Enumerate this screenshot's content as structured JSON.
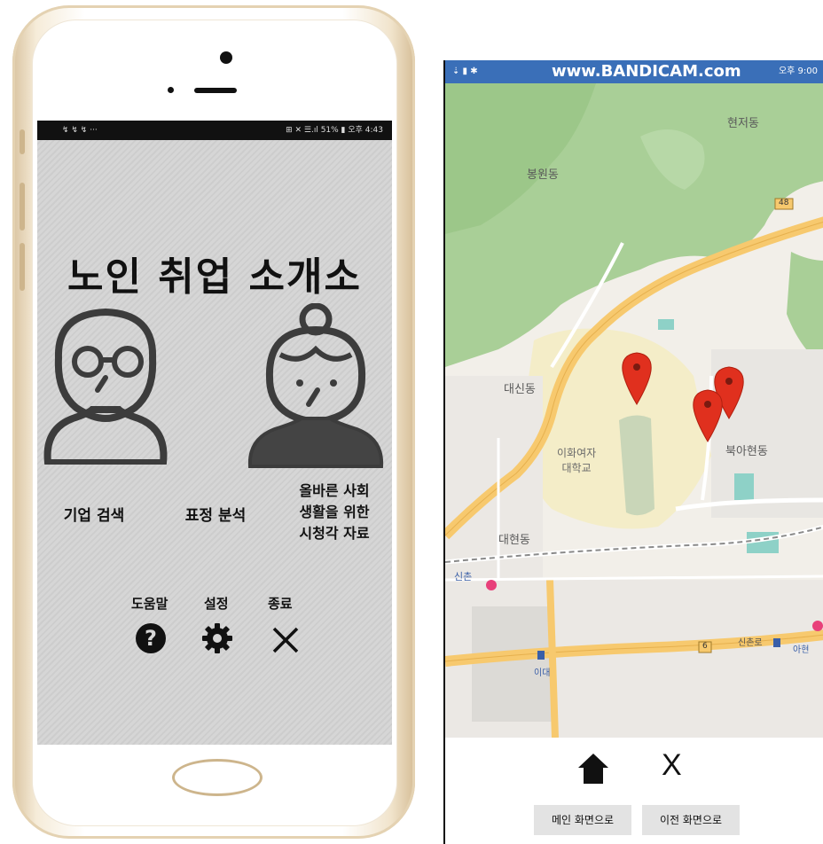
{
  "left_app": {
    "status_left": "↯ ↯ ↯  ···",
    "status_right": "⊞ ✕ ☰.ıl 51% ▮ 오후 4:43",
    "title": "노인 취업 소개소",
    "menu": {
      "company_search": "기업 검색",
      "expression_analysis": "표정 분석",
      "av_materials_line1": "올바른 사회",
      "av_materials_line2": "생활을 위한",
      "av_materials_line3": "시청각 자료"
    },
    "bottom": {
      "help_label": "도움말",
      "settings_label": "설정",
      "exit_label": "종료"
    }
  },
  "right_app": {
    "watermark": "www.BANDICAM.com",
    "status_right": "오후 9:00",
    "map_labels": {
      "hyeonjeo": "현저동",
      "bongwon": "봉원동",
      "daesin": "대신동",
      "ewha": "이화여자\n대학교",
      "bugahyeon": "북아현동",
      "daehyeon": "대현동",
      "sinchon": "신촌",
      "sinchon_ro": "신촌로",
      "ewha_small": "이대",
      "ahyeon": "아현",
      "road_48": "48",
      "road_6": "6"
    },
    "controls": {
      "home_icon_label": "home",
      "close_icon_label": "X",
      "main_button": "메인 화면으로",
      "prev_button": "이전 화면으로"
    }
  },
  "colors": {
    "pin": "#e0301e",
    "forest": "#a9cf97",
    "road": "#f7c96e",
    "campus": "#f4edc8"
  }
}
